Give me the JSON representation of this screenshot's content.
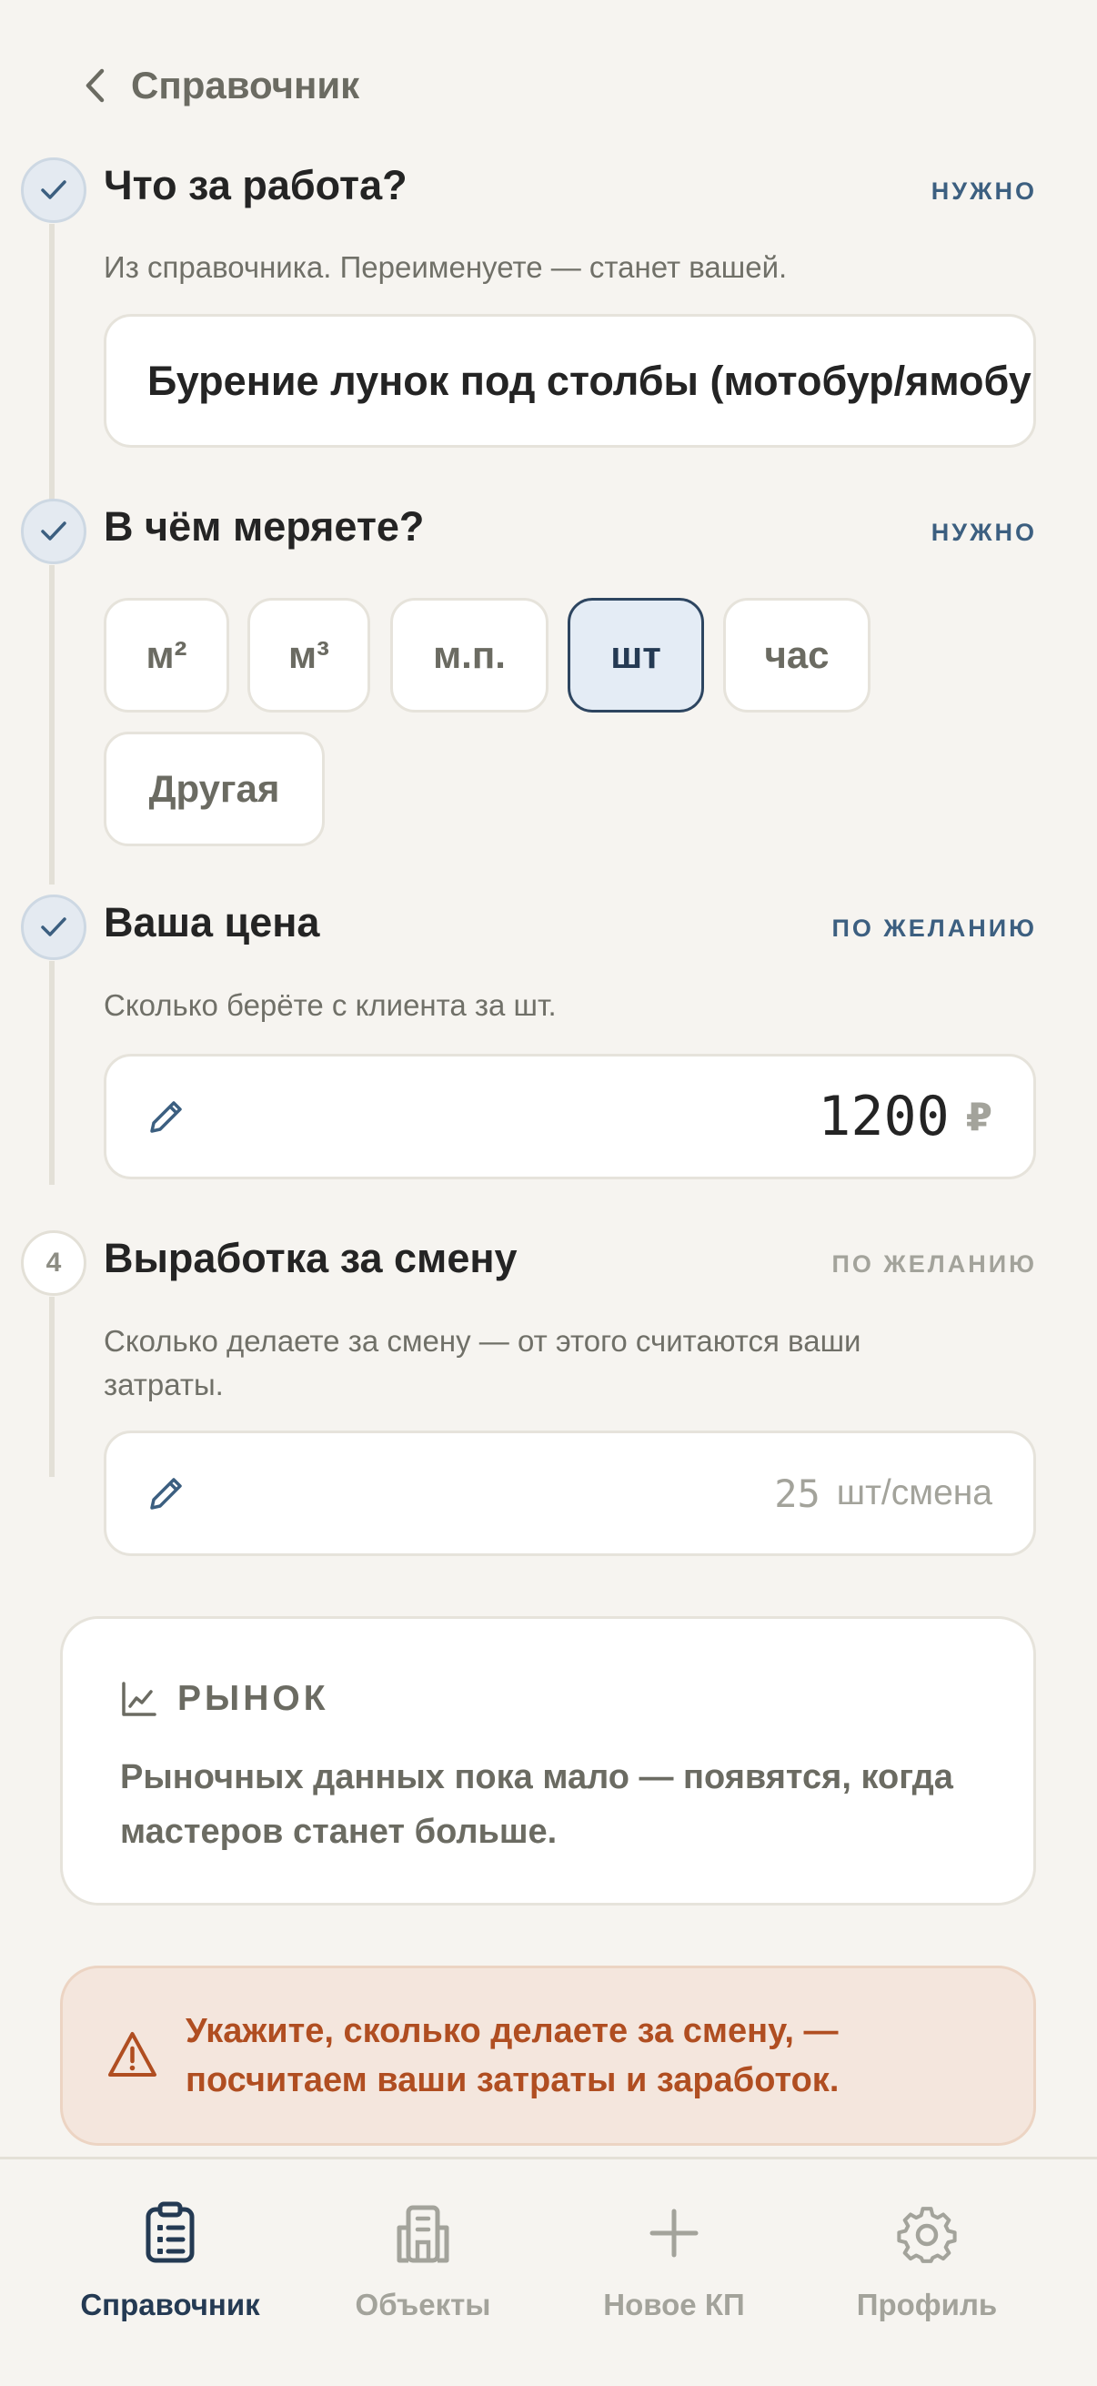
{
  "header": {
    "back_label": "Справочник"
  },
  "sections": {
    "name": {
      "title": "Что за работа?",
      "tag": "НУЖНО",
      "hint": "Из справочника. Переименуете — станет вашей.",
      "value": "Бурение лунок под столбы (мотобур/ямобур)"
    },
    "unit": {
      "title": "В чём меряете?",
      "tag": "НУЖНО",
      "options": [
        "м²",
        "м³",
        "м.п.",
        "шт",
        "час",
        "Другая"
      ],
      "selected": "шт"
    },
    "price": {
      "title": "Ваша цена",
      "tag": "ПО ЖЕЛАНИЮ",
      "hint": "Сколько берёте с клиента за шт.",
      "value": "1200",
      "unit": "₽"
    },
    "output": {
      "step": "4",
      "title": "Выработка за смену",
      "tag": "ПО ЖЕЛАНИЮ",
      "hint_line1": "Сколько делаете за смену — от этого считаются ваши",
      "hint_line2": "затраты.",
      "placeholder": "25",
      "unit": "шт/смена"
    }
  },
  "market": {
    "label": "РЫНОК",
    "text": "Рыночных данных пока мало — появятся, когда мастеров станет больше."
  },
  "warning": {
    "text": "Укажите, сколько делаете за смену, — посчитаем ваши затраты и заработок."
  },
  "nav": {
    "items": [
      {
        "label": "Справочник",
        "icon": "clipboard-list-icon",
        "active": true
      },
      {
        "label": "Объекты",
        "icon": "building-icon",
        "active": false
      },
      {
        "label": "Новое КП",
        "icon": "plus-icon",
        "active": false
      },
      {
        "label": "Профиль",
        "icon": "gear-icon",
        "active": false
      }
    ]
  },
  "colors": {
    "background": "#f6f4f0",
    "accent": "#243a53",
    "tag_required": "#3c5f80",
    "warning_text": "#b04e21",
    "warning_bg": "#f4e6dd"
  }
}
